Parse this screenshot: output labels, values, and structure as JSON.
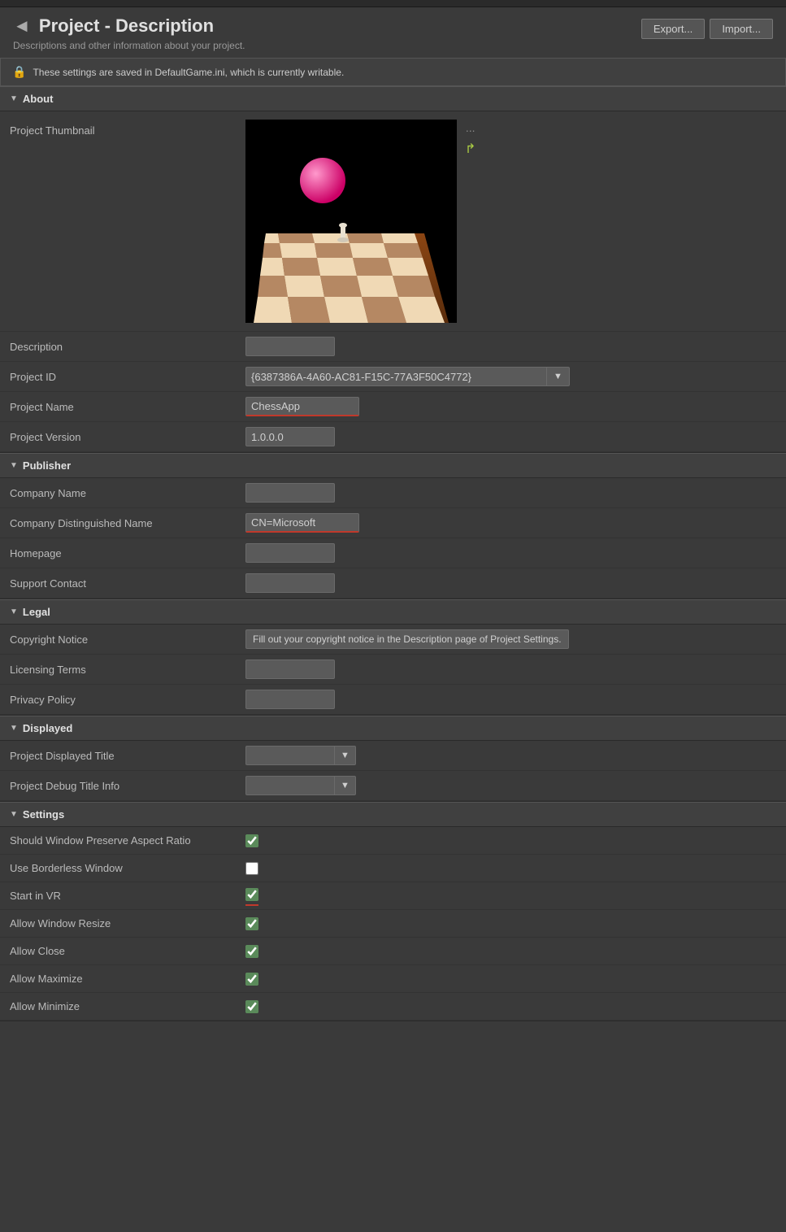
{
  "page": {
    "title": "Project - Description",
    "title_arrow": "◄",
    "subtitle": "Descriptions and other information about your project.",
    "export_btn": "Export...",
    "import_btn": "Import...",
    "notice": "These settings are saved in DefaultGame.ini, which is currently writable."
  },
  "sections": {
    "about": {
      "label": "About",
      "thumbnail_label": "Project Thumbnail",
      "description_label": "Description",
      "description_value": "",
      "project_id_label": "Project ID",
      "project_id_value": "{6387386A-4A60-AC81-F15C-77A3F50C4772}",
      "project_name_label": "Project Name",
      "project_name_value": "ChessApp",
      "project_version_label": "Project Version",
      "project_version_value": "1.0.0.0"
    },
    "publisher": {
      "label": "Publisher",
      "company_name_label": "Company Name",
      "company_name_value": "",
      "company_dn_label": "Company Distinguished Name",
      "company_dn_value": "CN=Microsoft",
      "homepage_label": "Homepage",
      "homepage_value": "",
      "support_label": "Support Contact",
      "support_value": ""
    },
    "legal": {
      "label": "Legal",
      "copyright_label": "Copyright Notice",
      "copyright_value": "Fill out your copyright notice in the Description page of Project Settings.",
      "licensing_label": "Licensing Terms",
      "licensing_value": "",
      "privacy_label": "Privacy Policy",
      "privacy_value": ""
    },
    "displayed": {
      "label": "Displayed",
      "title_label": "Project Displayed Title",
      "title_value": "",
      "debug_label": "Project Debug Title Info",
      "debug_value": ""
    },
    "settings": {
      "label": "Settings",
      "preserve_aspect_label": "Should Window Preserve Aspect Ratio",
      "preserve_aspect_checked": true,
      "borderless_label": "Use Borderless Window",
      "borderless_checked": false,
      "start_vr_label": "Start in VR",
      "start_vr_checked": true,
      "allow_resize_label": "Allow Window Resize",
      "allow_resize_checked": true,
      "allow_close_label": "Allow Close",
      "allow_close_checked": true,
      "allow_maximize_label": "Allow Maximize",
      "allow_maximize_checked": true,
      "allow_minimize_label": "Allow Minimize",
      "allow_minimize_checked": true
    }
  },
  "icons": {
    "lock": "🔒",
    "dots": "...",
    "refresh": "↺",
    "down_arrow": "▼",
    "section_down": "▼"
  }
}
